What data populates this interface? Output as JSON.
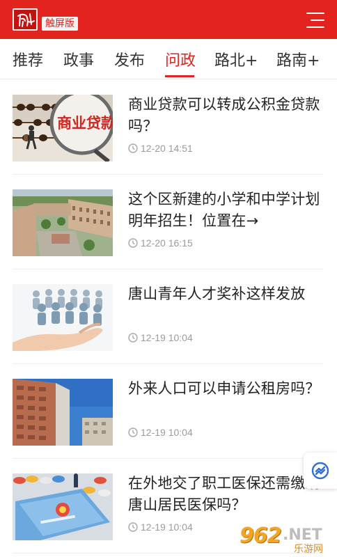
{
  "header": {
    "badge": "触屏版",
    "brand_color": "#e3231e"
  },
  "tabs": [
    {
      "label": "推荐",
      "active": false
    },
    {
      "label": "政事",
      "active": false
    },
    {
      "label": "发布",
      "active": false
    },
    {
      "label": "问政",
      "active": true
    },
    {
      "label": "路北+",
      "active": false
    },
    {
      "label": "路南+",
      "active": false
    }
  ],
  "articles": [
    {
      "title": "商业贷款可以转成公积金贷款吗？",
      "time": "12-20 14:51",
      "thumb_icon": "abacus-loan-image",
      "thumb_text": "商业贷款"
    },
    {
      "title": "这个区新建的小学和中学计划明年招生！位置在→",
      "time": "12-20 16:15",
      "thumb_icon": "school-aerial-image"
    },
    {
      "title": "唐山青年人才奖补这样发放",
      "time": "12-19 10:04",
      "thumb_icon": "hand-people-image"
    },
    {
      "title": "外来人口可以申请公租房吗？",
      "time": "12-19 10:04",
      "thumb_icon": "apartment-building-image"
    },
    {
      "title": "在外地交了职工医保还需缴纳唐山居民医保吗？",
      "time": "12-19 10:04",
      "thumb_icon": "medical-card-image"
    }
  ],
  "icons": {
    "clock": "clock-icon",
    "menu": "menu-icon",
    "fab": "share-icon"
  },
  "watermark": {
    "number": "962",
    "suffix": ".NET",
    "name": "乐游网"
  }
}
